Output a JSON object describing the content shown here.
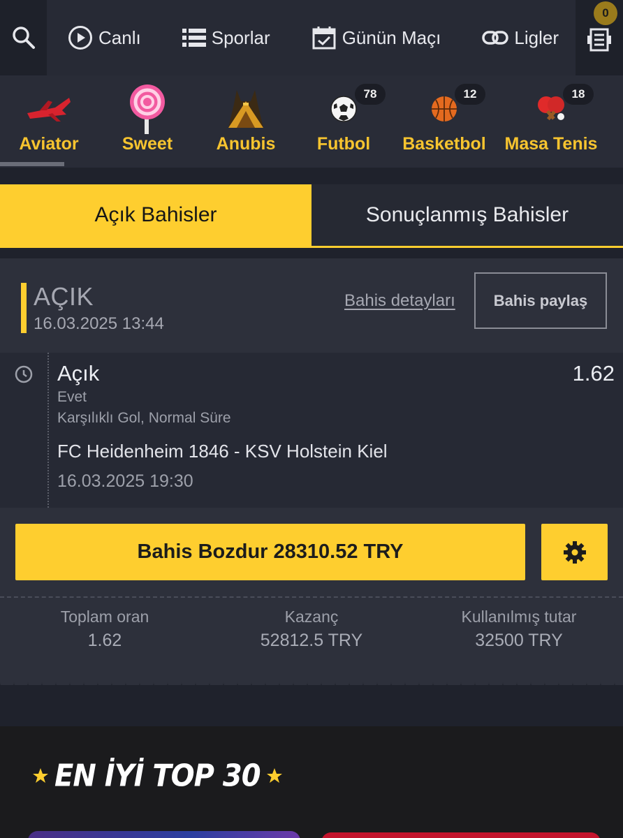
{
  "nav": {
    "items": [
      {
        "label": "Canlı",
        "icon": "play-circle-icon"
      },
      {
        "label": "Sporlar",
        "icon": "list-icon"
      },
      {
        "label": "Günün Maçı",
        "icon": "calendar-check-icon"
      },
      {
        "label": "Ligler",
        "icon": "link-icon"
      }
    ],
    "betslip_count": "0"
  },
  "categories": [
    {
      "label": "Aviator",
      "icon": "plane-icon"
    },
    {
      "label": "Sweet",
      "icon": "lollipop-icon"
    },
    {
      "label": "Anubis",
      "icon": "anubis-icon"
    },
    {
      "label": "Futbol",
      "icon": "soccer-ball-icon",
      "count": "78"
    },
    {
      "label": "Basketbol",
      "icon": "basketball-icon",
      "count": "12"
    },
    {
      "label": "Masa Tenis",
      "icon": "table-tennis-icon",
      "count": "18"
    }
  ],
  "tabs": {
    "open": "Açık Bahisler",
    "settled": "Sonuçlanmış Bahisler"
  },
  "bet": {
    "status": "AÇIK",
    "placed_at": "16.03.2025  13:44",
    "details_link": "Bahis detayları",
    "share_button": "Bahis paylaş",
    "selection": {
      "status": "Açık",
      "odds": "1.62",
      "outcome": "Evet",
      "market": "Karşılıklı Gol, Normal Süre",
      "match": "FC Heidenheim 1846  -  KSV Holstein Kiel",
      "match_time": "16.03.2025  19:30"
    },
    "cashout_button": "Bahis Bozdur 28310.52 TRY",
    "summary": {
      "total_odds_label": "Toplam oran",
      "total_odds": "1.62",
      "winnings_label": "Kazanç",
      "winnings": "52812.5 TRY",
      "stake_label": "Kullanılmış tutar",
      "stake": "32500 TRY"
    }
  },
  "promo": {
    "title": "EN İYİ TOP 30"
  },
  "colors": {
    "accent": "#fece2f",
    "nav_bg": "#272a35",
    "card_bg": "#2d303b"
  }
}
